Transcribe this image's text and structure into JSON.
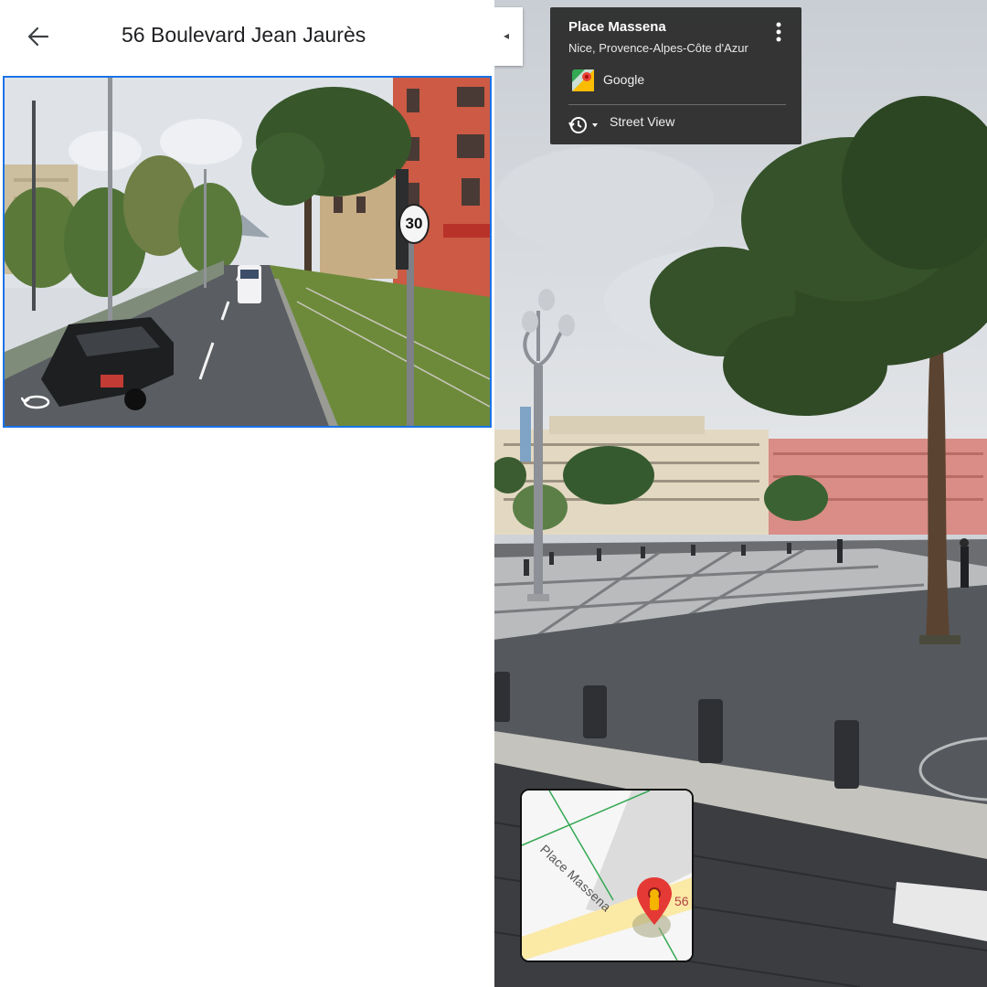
{
  "header": {
    "title": "56 Boulevard Jean Jaurès",
    "back_icon": "arrow-left-icon"
  },
  "thumbnail": {
    "speed_sign": "30",
    "rotate_icon": "rotate-360-icon"
  },
  "info_card": {
    "place_name": "Place Massena",
    "region": "Nice, Provence-Alpes-Côte d'Azur",
    "provider": "Google",
    "mode": "Street View",
    "more_icon": "more-vertical-icon",
    "history_icon": "history-icon",
    "maps_icon": "google-maps-icon"
  },
  "collapse": {
    "icon": "◂"
  },
  "mini_map": {
    "street": "Place Massena",
    "house_number": "56",
    "pin_icon": "location-pin-icon"
  },
  "colors": {
    "accent": "#1a73e8",
    "card_bg": "#282828",
    "pin_red": "#e53935",
    "route_yellow": "#fbe9a6"
  }
}
